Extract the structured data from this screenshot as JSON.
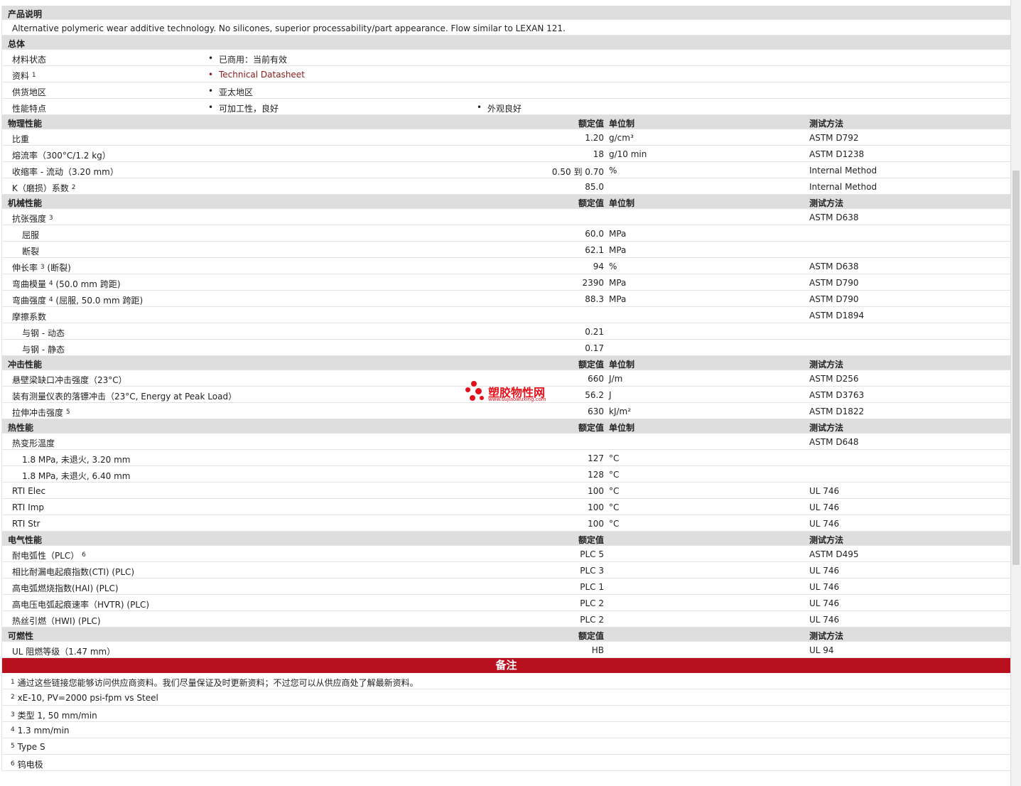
{
  "desc_section": {
    "title": "产品说明",
    "text": "Alternative polymeric wear additive technology. No silicones, superior processability/part appearance. Flow similar to LEXAN 121."
  },
  "general": {
    "title": "总体",
    "rows": [
      {
        "label": "材料状态",
        "items": [
          "已商用：当前有效"
        ]
      },
      {
        "label": "资料",
        "sup": "1",
        "items": [
          "Technical Datasheet"
        ],
        "link": true
      },
      {
        "label": "供货地区",
        "items": [
          "亚太地区"
        ]
      },
      {
        "label": "性能特点",
        "items": [
          "可加工性，良好",
          "外观良好"
        ]
      }
    ]
  },
  "headers": {
    "value": "额定值",
    "unit": "单位制",
    "method": "测试方法"
  },
  "sections": [
    {
      "title": "物理性能",
      "show_unit": true,
      "rows": [
        {
          "label": "比重",
          "value": "1.20",
          "unit": "g/cm³",
          "method": "ASTM D792"
        },
        {
          "label": "熔流率（300°C/1.2 kg）",
          "value": "18",
          "unit": "g/10 min",
          "method": "ASTM D1238"
        },
        {
          "label": "收缩率 - 流动（3.20 mm）",
          "value": "0.50 到  0.70",
          "unit": "%",
          "method": "Internal Method"
        },
        {
          "label": "K（磨损）系数",
          "sup": "2",
          "value": "85.0",
          "unit": "",
          "method": "Internal Method"
        }
      ]
    },
    {
      "title": "机械性能",
      "show_unit": true,
      "rows": [
        {
          "label": "抗张强度",
          "sup": "3",
          "value": "",
          "unit": "",
          "method": "ASTM D638"
        },
        {
          "label": "屈服",
          "sub": true,
          "value": "60.0",
          "unit": "MPa",
          "method": ""
        },
        {
          "label": "断裂",
          "sub": true,
          "value": "62.1",
          "unit": "MPa",
          "method": ""
        },
        {
          "label": "伸长率",
          "sup": "3",
          "suffix": "(断裂)",
          "value": "94",
          "unit": "%",
          "method": "ASTM D638"
        },
        {
          "label": "弯曲模量",
          "sup": "4",
          "suffix": "(50.0 mm 跨距)",
          "value": "2390",
          "unit": "MPa",
          "method": "ASTM D790"
        },
        {
          "label": "弯曲强度",
          "sup": "4",
          "suffix": "(屈服, 50.0 mm 跨距)",
          "value": "88.3",
          "unit": "MPa",
          "method": "ASTM D790"
        },
        {
          "label": "摩擦系数",
          "value": "",
          "unit": "",
          "method": "ASTM D1894"
        },
        {
          "label": "与钢 - 动态",
          "sub": true,
          "value": "0.21",
          "unit": "",
          "method": ""
        },
        {
          "label": "与钢 - 静态",
          "sub": true,
          "value": "0.17",
          "unit": "",
          "method": ""
        }
      ]
    },
    {
      "title": "冲击性能",
      "show_unit": true,
      "rows": [
        {
          "label": "悬壁梁缺口冲击强度（23°C）",
          "value": "660",
          "unit": "J/m",
          "method": "ASTM D256"
        },
        {
          "label": "装有测量仪表的落镖冲击（23°C, Energy at Peak Load）",
          "value": "56.2",
          "unit": "J",
          "method": "ASTM D3763"
        },
        {
          "label": "拉伸冲击强度",
          "sup": "5",
          "value": "630",
          "unit": "kJ/m²",
          "method": "ASTM D1822"
        }
      ]
    },
    {
      "title": "热性能",
      "show_unit": true,
      "rows": [
        {
          "label": "热变形温度",
          "value": "",
          "unit": "",
          "method": "ASTM D648"
        },
        {
          "label": "1.8 MPa, 未退火, 3.20 mm",
          "sub": true,
          "value": "127",
          "unit": "°C",
          "method": ""
        },
        {
          "label": "1.8 MPa, 未退火, 6.40 mm",
          "sub": true,
          "value": "128",
          "unit": "°C",
          "method": ""
        },
        {
          "label": "RTI Elec",
          "value": "100",
          "unit": "°C",
          "method": "UL 746"
        },
        {
          "label": "RTI Imp",
          "value": "100",
          "unit": "°C",
          "method": "UL 746"
        },
        {
          "label": "RTI Str",
          "value": "100",
          "unit": "°C",
          "method": "UL 746"
        }
      ]
    },
    {
      "title": "电气性能",
      "show_unit": false,
      "rows": [
        {
          "label": "耐电弧性（PLC）",
          "sup": "6",
          "value": "PLC 5",
          "unit": "",
          "method": "ASTM D495"
        },
        {
          "label": "相比耐漏电起痕指数(CTI) (PLC)",
          "value": "PLC 3",
          "unit": "",
          "method": "UL 746"
        },
        {
          "label": "高电弧燃烧指数(HAI) (PLC)",
          "value": "PLC 1",
          "unit": "",
          "method": "UL 746"
        },
        {
          "label": "高电压电弧起痕速率（HVTR) (PLC)",
          "value": "PLC 2",
          "unit": "",
          "method": "UL 746"
        },
        {
          "label": "热丝引燃（HWI) (PLC)",
          "value": "PLC 2",
          "unit": "",
          "method": "UL 746"
        }
      ]
    },
    {
      "title": "可燃性",
      "show_unit": false,
      "rows": [
        {
          "label": "UL 阻燃等级（1.47 mm）",
          "value": "HB",
          "unit": "",
          "method": "UL 94"
        }
      ]
    }
  ],
  "notes": {
    "title": "备注",
    "items": [
      {
        "num": "1",
        "text": "通过这些链接您能够访问供应商资料。我们尽量保证及时更新资料；不过您可以从供应商处了解最新资料。"
      },
      {
        "num": "2",
        "text": "xE-10, PV=2000 psi-fpm vs Steel"
      },
      {
        "num": "3",
        "text": "类型  1, 50 mm/min"
      },
      {
        "num": "4",
        "text": "1.3 mm/min"
      },
      {
        "num": "5",
        "text": "Type S"
      },
      {
        "num": "6",
        "text": "钨电极"
      }
    ]
  },
  "watermark": {
    "name": "塑胶物性网",
    "url": "www.sujiaowuxing.com",
    "color": "#e3101b"
  },
  "colors": {
    "section_bg": "#dedede",
    "notes_bg": "#b8101e",
    "link": "#8b1a1a"
  }
}
